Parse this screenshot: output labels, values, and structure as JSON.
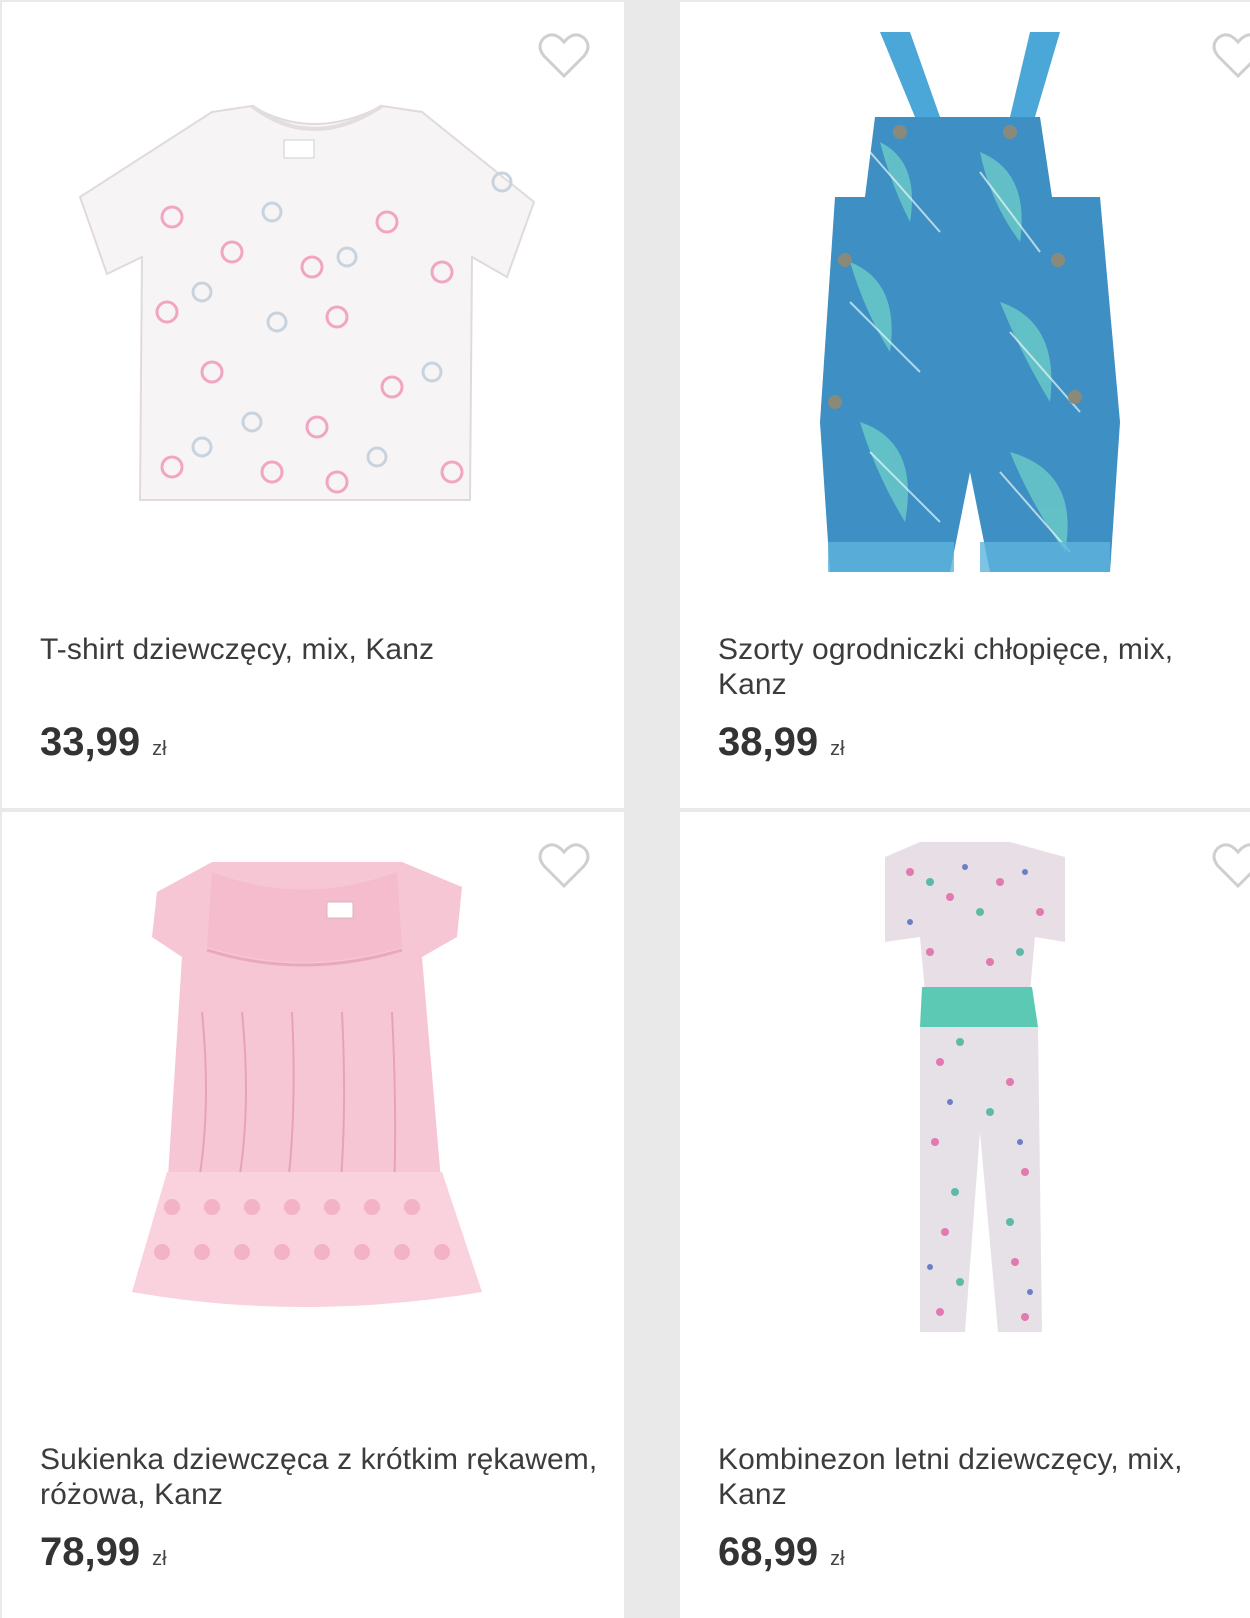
{
  "products": [
    {
      "title": "T-shirt dziewczęcy, mix, Kanz",
      "price": "33,99",
      "currency": "zł",
      "favorite_icon": "heart-outline-icon"
    },
    {
      "title": "Szorty ogrodniczki chłopięce, mix, Kanz",
      "price": "38,99",
      "currency": "zł",
      "favorite_icon": "heart-outline-icon"
    },
    {
      "title": "Sukienka dziewczęca z krótkim rękawem, różowa, Kanz",
      "price": "78,99",
      "currency": "zł",
      "favorite_icon": "heart-outline-icon"
    },
    {
      "title": "Kombinezon letni dziewczęcy, mix, Kanz",
      "price": "68,99",
      "currency": "zł",
      "favorite_icon": "heart-outline-icon"
    }
  ],
  "colors": {
    "background": "#e9e9e9",
    "card": "#ffffff",
    "text": "#3c3c3c",
    "heart": "#cfcfcf"
  }
}
